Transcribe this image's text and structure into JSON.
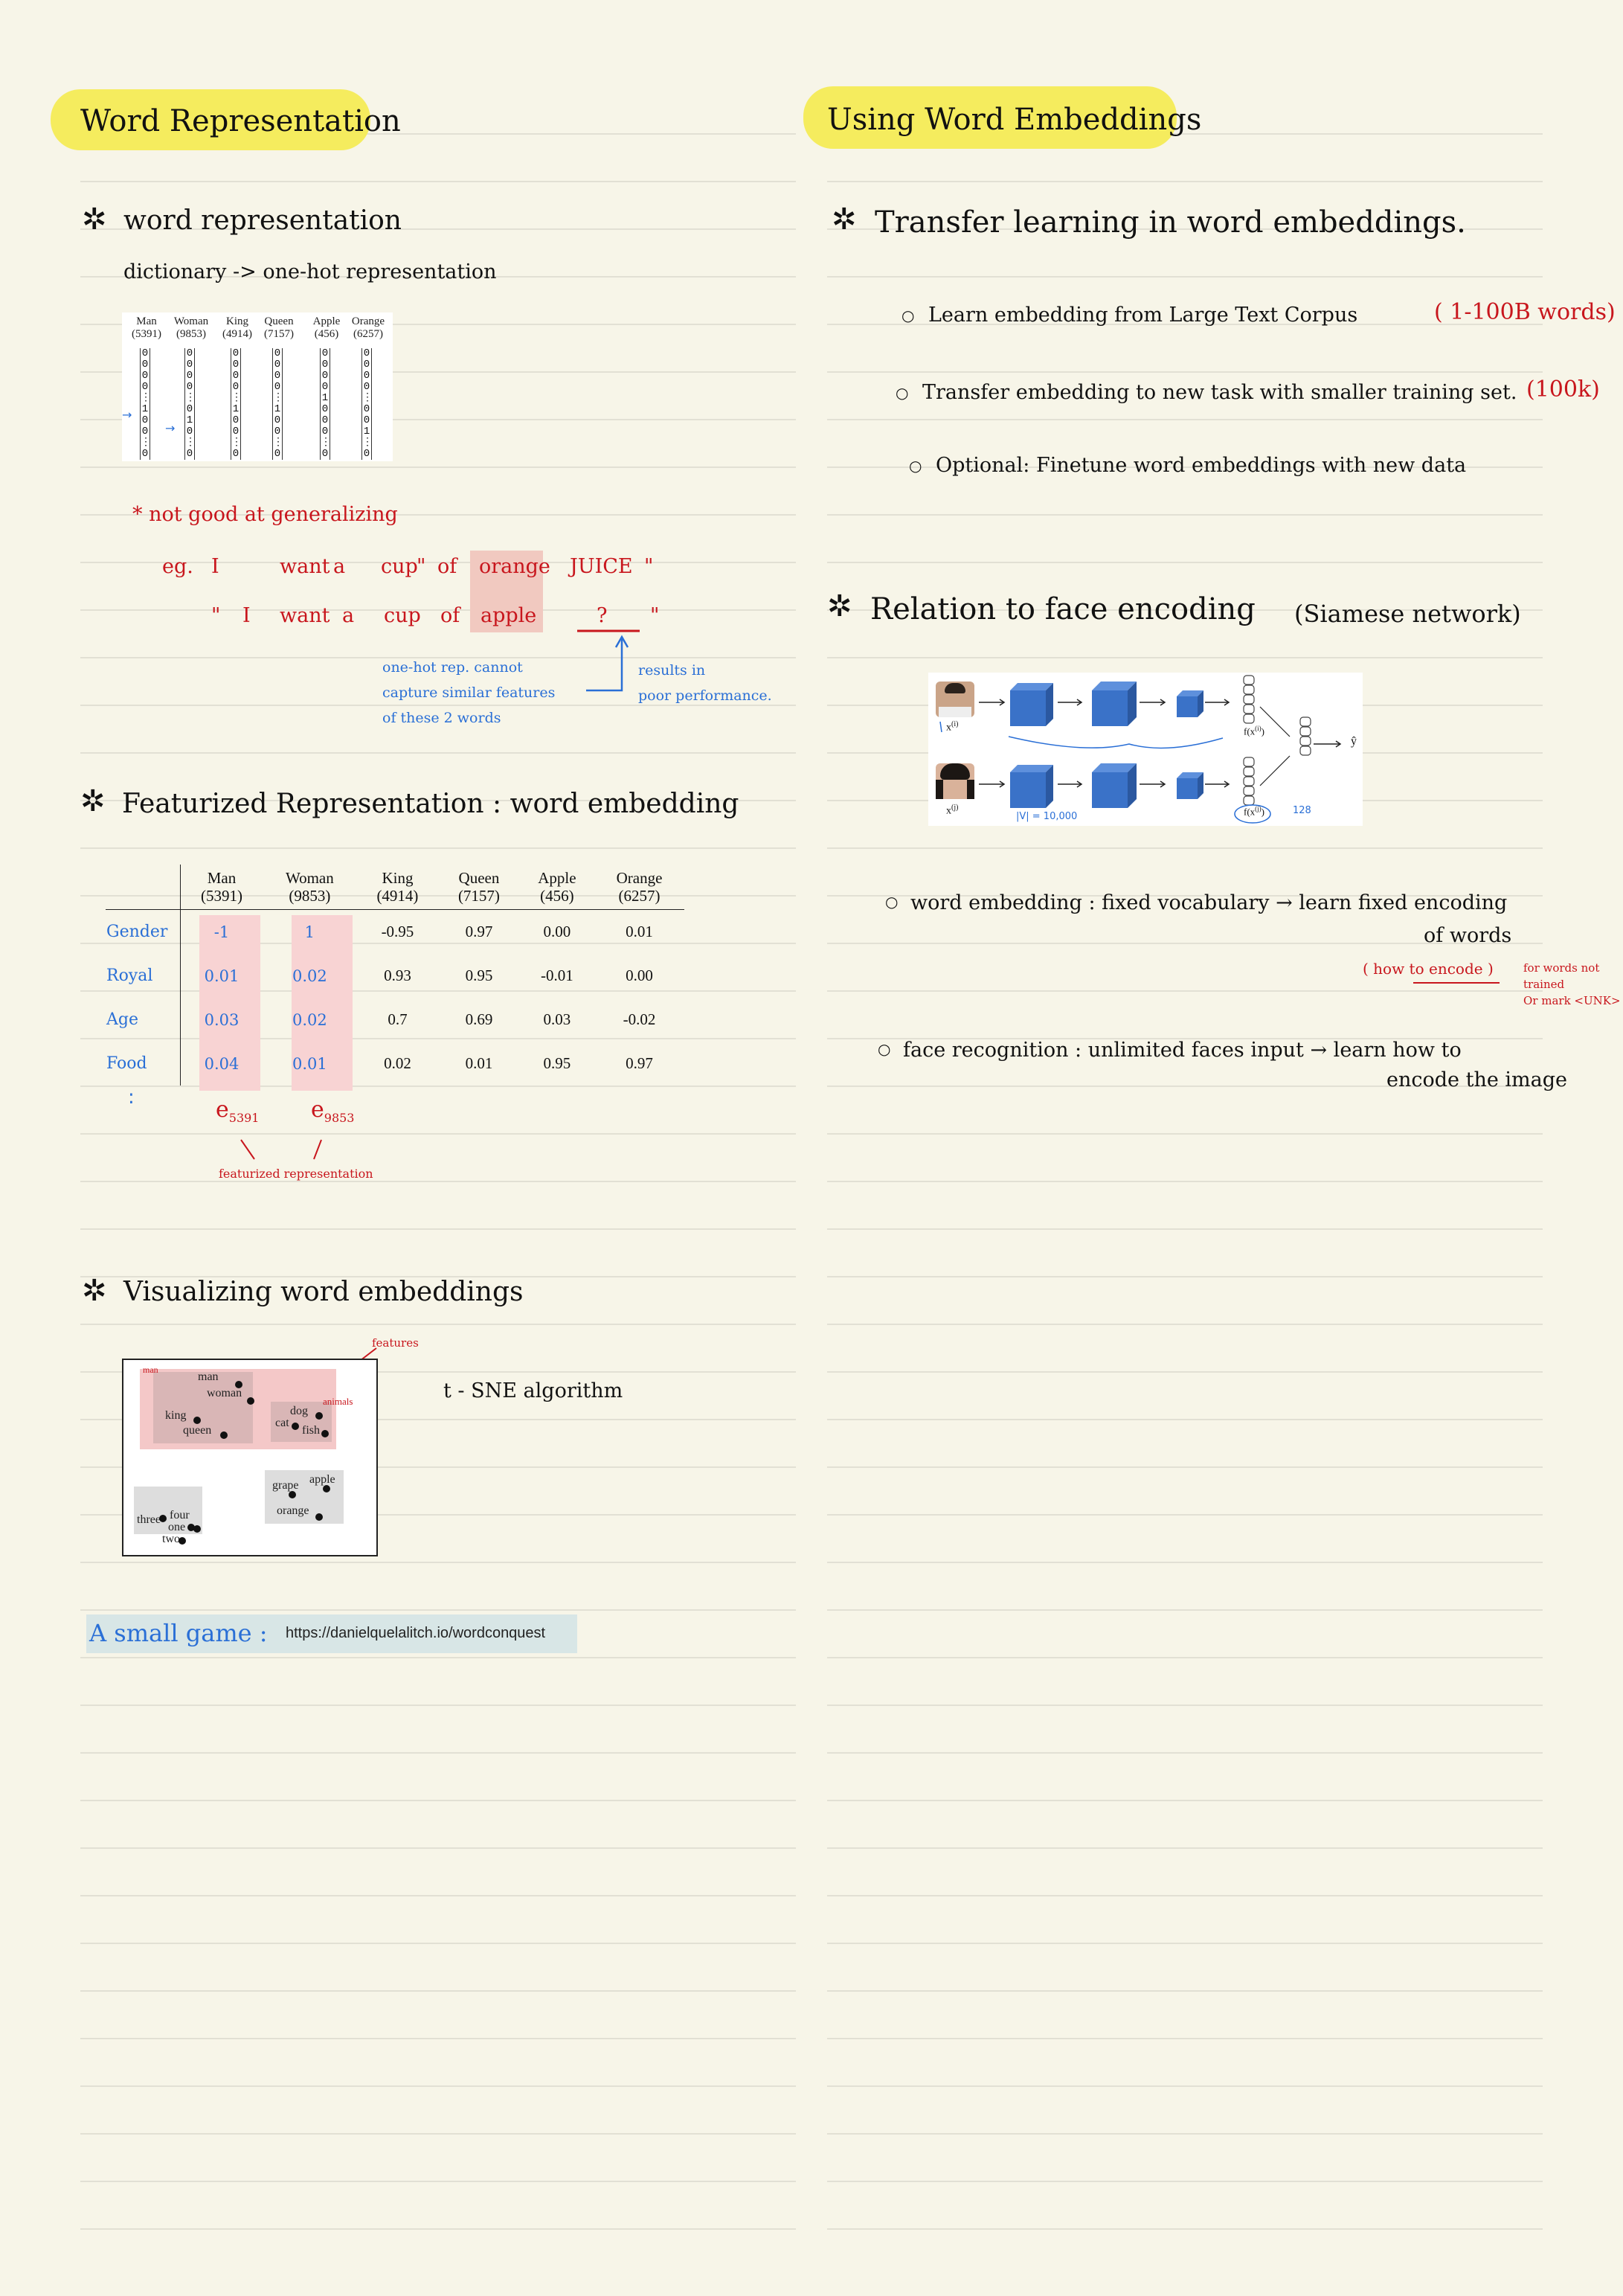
{
  "left": {
    "title": "Word Representation",
    "s1": {
      "heading": "word representation",
      "subtitle": "dictionary -> one-hot representation",
      "onehot": {
        "words": [
          "Man",
          "Woman",
          "King",
          "Queen",
          "Apple",
          "Orange"
        ],
        "indices": [
          "(5391)",
          "(9853)",
          "(4914)",
          "(7157)",
          "(456)",
          "(6257)"
        ]
      },
      "note": "* not good at generalizing",
      "eg_label": "eg.",
      "ex1": [
        "\"",
        "I",
        "want",
        "a",
        "cup",
        "of",
        "orange",
        "JUICE",
        "\""
      ],
      "ex2": [
        "\"",
        "I",
        "want",
        "a",
        "cup",
        "of",
        "apple",
        "?",
        "\""
      ],
      "blue_note": [
        "one-hot rep. cannot",
        "capture similar features",
        "of these 2 words"
      ],
      "blue_result": [
        "results in",
        "poor performance."
      ]
    },
    "s2": {
      "heading": "Featurized Representation : word embedding",
      "columns": [
        {
          "name": "Man",
          "index": "(5391)"
        },
        {
          "name": "Woman",
          "index": "(9853)"
        },
        {
          "name": "King",
          "index": "(4914)"
        },
        {
          "name": "Queen",
          "index": "(7157)"
        },
        {
          "name": "Apple",
          "index": "(456)"
        },
        {
          "name": "Orange",
          "index": "(6257)"
        }
      ],
      "rows": [
        {
          "feature": "Gender",
          "values": [
            "-1",
            "1",
            "-0.95",
            "0.97",
            "0.00",
            "0.01"
          ]
        },
        {
          "feature": "Royal",
          "values": [
            "0.01",
            "0.02",
            "0.93",
            "0.95",
            "-0.01",
            "0.00"
          ]
        },
        {
          "feature": "Age",
          "values": [
            "0.03",
            "0.02",
            "0.7",
            "0.69",
            "0.03",
            "-0.02"
          ]
        },
        {
          "feature": "Food",
          "values": [
            "0.04",
            "0.01",
            "0.02",
            "0.01",
            "0.95",
            "0.97"
          ]
        }
      ],
      "more_rows": ":",
      "e_man": "e5391",
      "e_woman": "e9853",
      "featurized": "featurized representation"
    },
    "s3": {
      "heading": "Visualizing word embeddings",
      "algorithm": "t - SNE algorithm",
      "features_label": "features",
      "tsne_words": [
        "man",
        "woman",
        "king",
        "queen",
        "dog",
        "cat",
        "fish",
        "apple",
        "grape",
        "orange",
        "three",
        "four",
        "one",
        "two"
      ],
      "tsne_annotations": [
        "man",
        "animals"
      ]
    },
    "game": {
      "label": "A small game :",
      "url": "https://danielquelalitch.io/wordconquest"
    }
  },
  "right": {
    "title": "Using Word Embeddings",
    "s1": {
      "heading": "Transfer learning in word embeddings.",
      "bullets": [
        {
          "text": "Learn embedding from Large Text Corpus",
          "note": "( 1-100B words)"
        },
        {
          "text": "Transfer embedding to new task with smaller training set.",
          "note": "(100k)"
        },
        {
          "text": "Optional: Finetune word embeddings with new data",
          "note": ""
        }
      ]
    },
    "s2": {
      "heading": "Relation to face encoding",
      "paren": "(Siamese network)",
      "figure": {
        "x_i": "x(i)",
        "x_j": "x(j)",
        "f_i": "f(x(i))",
        "f_j": "f(x(j))",
        "yhat": "ŷ",
        "vocab_note": "|V| = 10,000",
        "dim_note": "128"
      },
      "b1_text": "word embedding : fixed vocabulary → learn fixed encoding",
      "b1_cont": "of words",
      "b1_red": "( how to encode )",
      "b1_red_side": [
        "for words not",
        "trained",
        "Or mark <UNK>"
      ],
      "b2_text": "face recognition : unlimited faces input → learn how to",
      "b2_cont": "encode the image"
    }
  },
  "colors": {
    "highlight": "#f5ec5e",
    "red_ink": "#c8161d",
    "blue_ink": "#2a6fd6",
    "paper": "#f7f5e8",
    "pink": "#f5cfcf"
  }
}
